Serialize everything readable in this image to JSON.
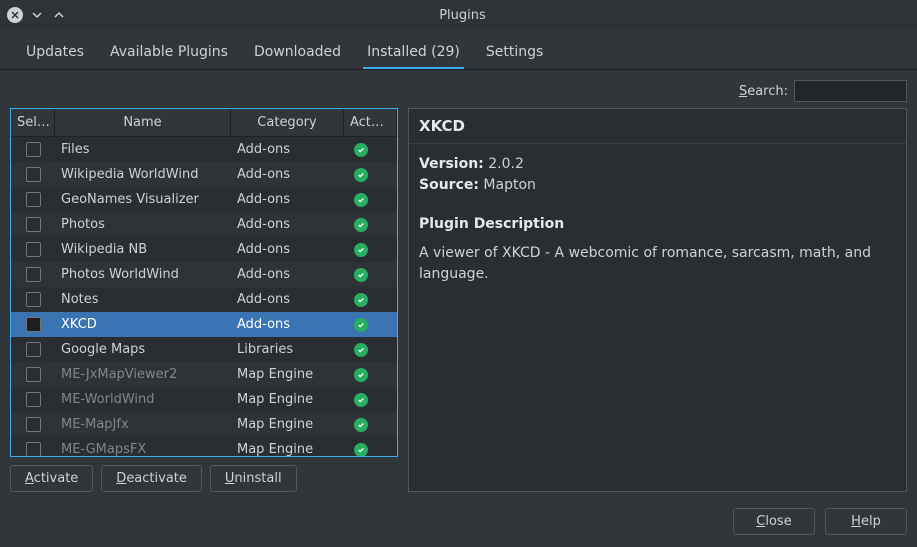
{
  "window": {
    "title": "Plugins"
  },
  "tabs": {
    "items": [
      {
        "label": "Updates",
        "active": false
      },
      {
        "label": "Available Plugins",
        "active": false
      },
      {
        "label": "Downloaded",
        "active": false
      },
      {
        "label": "Installed (29)",
        "active": true
      },
      {
        "label": "Settings",
        "active": false
      }
    ]
  },
  "search": {
    "label_prefix": "S",
    "label_rest": "earch:",
    "value": ""
  },
  "table": {
    "columns": {
      "select": "Sel…",
      "name": "Name",
      "category": "Category",
      "active": "Act…"
    },
    "rows": [
      {
        "name": "Files",
        "category": "Add-ons",
        "active": true,
        "dim": false,
        "selected": false
      },
      {
        "name": "Wikipedia WorldWind",
        "category": "Add-ons",
        "active": true,
        "dim": false,
        "selected": false
      },
      {
        "name": "GeoNames Visualizer",
        "category": "Add-ons",
        "active": true,
        "dim": false,
        "selected": false
      },
      {
        "name": "Photos",
        "category": "Add-ons",
        "active": true,
        "dim": false,
        "selected": false
      },
      {
        "name": "Wikipedia NB",
        "category": "Add-ons",
        "active": true,
        "dim": false,
        "selected": false
      },
      {
        "name": "Photos WorldWind",
        "category": "Add-ons",
        "active": true,
        "dim": false,
        "selected": false
      },
      {
        "name": "Notes",
        "category": "Add-ons",
        "active": true,
        "dim": false,
        "selected": false
      },
      {
        "name": "XKCD",
        "category": "Add-ons",
        "active": true,
        "dim": false,
        "selected": true
      },
      {
        "name": "Google Maps",
        "category": "Libraries",
        "active": true,
        "dim": false,
        "selected": false
      },
      {
        "name": "ME-JxMapViewer2",
        "category": "Map Engine",
        "active": true,
        "dim": true,
        "selected": false
      },
      {
        "name": "ME-WorldWind",
        "category": "Map Engine",
        "active": true,
        "dim": true,
        "selected": false
      },
      {
        "name": "ME-MapJfx",
        "category": "Map Engine",
        "active": true,
        "dim": true,
        "selected": false
      },
      {
        "name": "ME-GMapsFX",
        "category": "Map Engine",
        "active": true,
        "dim": true,
        "selected": false
      }
    ]
  },
  "actions": {
    "activate_u": "A",
    "activate_r": "ctivate",
    "deactivate_u": "D",
    "deactivate_r": "eactivate",
    "uninstall_u": "U",
    "uninstall_r": "ninstall"
  },
  "details": {
    "title": "XKCD",
    "version_label": "Version:",
    "version_value": "2.0.2",
    "source_label": "Source:",
    "source_value": "Mapton",
    "pd_head": "Plugin Description",
    "pd_desc": "A viewer of XKCD - A webcomic of romance, sarcasm, math, and language."
  },
  "footer": {
    "close_u": "C",
    "close_r": "lose",
    "help_u": "H",
    "help_r": "elp"
  }
}
